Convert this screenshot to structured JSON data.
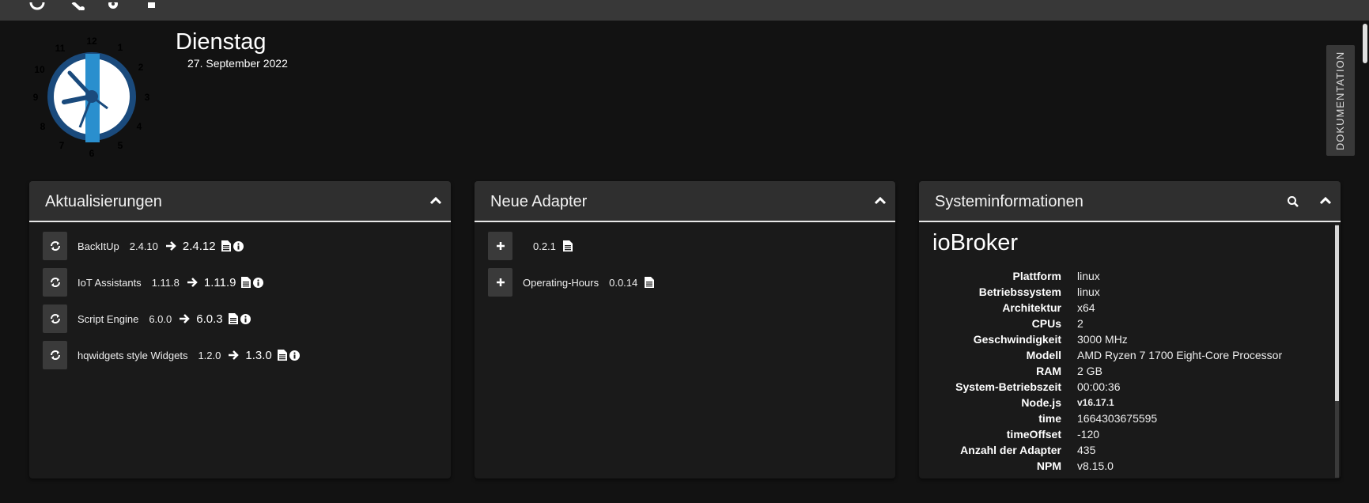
{
  "topbar": {
    "icons": [
      "refresh-icon",
      "wrench-icon",
      "gear-icon",
      "file-icon"
    ]
  },
  "clock": {
    "numbers": [
      "12",
      "1",
      "2",
      "3",
      "4",
      "5",
      "6",
      "7",
      "8",
      "9",
      "10",
      "11"
    ]
  },
  "header": {
    "day": "Dienstag",
    "date": "27. September 2022"
  },
  "doc_tab": {
    "label": "DOKUMENTATION"
  },
  "updates": {
    "title": "Aktualisierungen",
    "items": [
      {
        "name": "BackItUp",
        "from": "2.4.10",
        "to": "2.4.12"
      },
      {
        "name": "IoT Assistants",
        "from": "1.11.8",
        "to": "1.11.9"
      },
      {
        "name": "Script Engine",
        "from": "6.0.0",
        "to": "6.0.3"
      },
      {
        "name": "hqwidgets style Widgets",
        "from": "1.2.0",
        "to": "1.3.0"
      }
    ]
  },
  "new_adapters": {
    "title": "Neue Adapter",
    "items": [
      {
        "name": "",
        "version": "0.2.1"
      },
      {
        "name": "Operating-Hours",
        "version": "0.0.14"
      }
    ]
  },
  "sysinfo": {
    "title": "Systeminformationen",
    "heading": "ioBroker",
    "rows": [
      {
        "key": "Plattform",
        "value": "linux"
      },
      {
        "key": "Betriebssystem",
        "value": "linux"
      },
      {
        "key": "Architektur",
        "value": "x64"
      },
      {
        "key": "CPUs",
        "value": "2"
      },
      {
        "key": "Geschwindigkeit",
        "value": "3000 MHz"
      },
      {
        "key": "Modell",
        "value": "AMD Ryzen 7 1700 Eight-Core Processor"
      },
      {
        "key": "RAM",
        "value": "2 GB"
      },
      {
        "key": "System-Betriebszeit",
        "value": "00:00:36"
      },
      {
        "key": "Node.js",
        "value": "v16.17.1"
      },
      {
        "key": "time",
        "value": "1664303675595"
      },
      {
        "key": "timeOffset",
        "value": "-120"
      },
      {
        "key": "Anzahl der Adapter",
        "value": "435"
      },
      {
        "key": "NPM",
        "value": "v8.15.0"
      }
    ]
  },
  "colors": {
    "accent": "#2a8fce",
    "clock_ring": "#1a4a7c",
    "panel": "#1a1a1a",
    "header": "#2f2f2f"
  }
}
